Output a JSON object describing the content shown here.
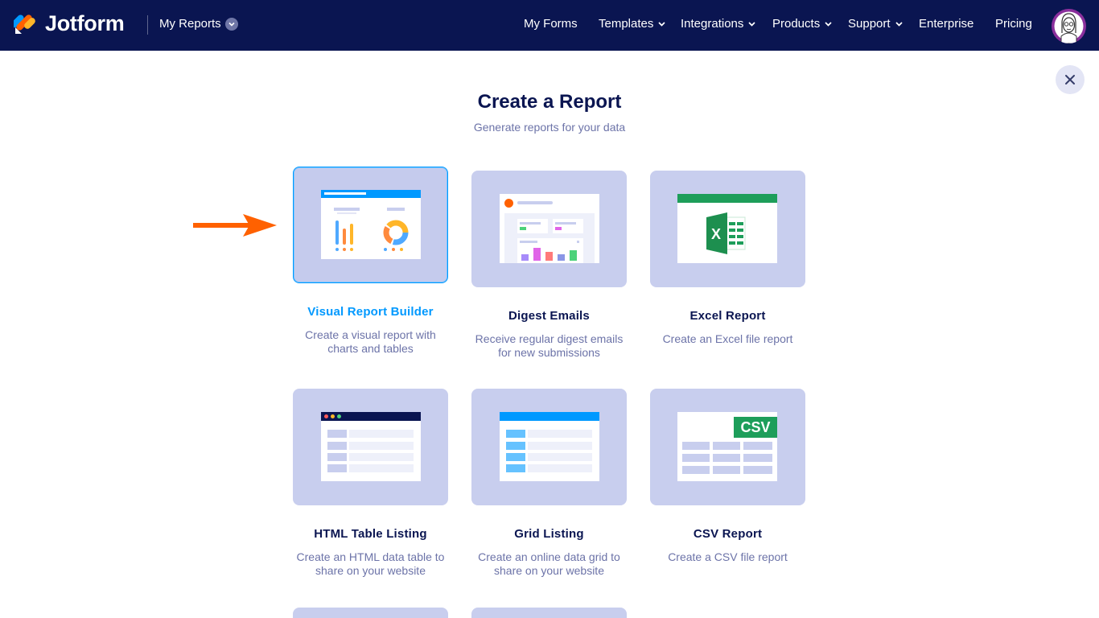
{
  "header": {
    "brand": "Jotform",
    "section_label": "My Reports",
    "nav": [
      {
        "label": "My Forms"
      },
      {
        "label": "Templates"
      },
      {
        "label": "Integrations"
      },
      {
        "label": "Products"
      },
      {
        "label": "Support"
      },
      {
        "label": "Enterprise"
      },
      {
        "label": "Pricing"
      }
    ]
  },
  "page": {
    "title": "Create a Report",
    "subtitle": "Generate reports for your data"
  },
  "cards": [
    {
      "title": "Visual Report Builder",
      "desc": "Create a visual report with charts and tables"
    },
    {
      "title": "Digest Emails",
      "desc": "Receive regular digest emails for new submissions"
    },
    {
      "title": "Excel Report",
      "desc": "Create an Excel file report"
    },
    {
      "title": "HTML Table Listing",
      "desc": "Create an HTML data table to share on your website"
    },
    {
      "title": "Grid Listing",
      "desc": "Create an online data grid to share on your website"
    },
    {
      "title": "CSV Report",
      "desc": "Create a CSV file report"
    }
  ],
  "csv_badge": "CSV",
  "excel_badge": "X",
  "colors": {
    "header_bg": "#0a1551",
    "tile_bg": "#c8ceee",
    "accent": "#0099ff",
    "arrow": "#ff6100"
  }
}
